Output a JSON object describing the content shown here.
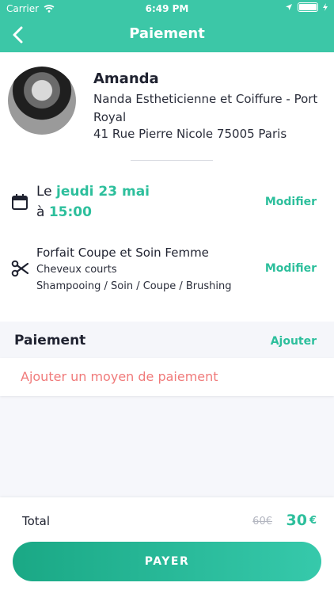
{
  "status_bar": {
    "carrier": "Carrier",
    "time": "6:49 PM"
  },
  "header": {
    "title": "Paiement"
  },
  "provider": {
    "name": "Amanda",
    "salon": "Nanda Estheticienne et Coiffure - Port Royal",
    "address": "41 Rue Pierre Nicole 75005 Paris"
  },
  "appointment": {
    "date_prefix": "Le",
    "date": "jeudi 23 mai",
    "time_prefix": "à",
    "time": "15:00",
    "modify_label": "Modifier"
  },
  "service": {
    "title": "Forfait Coupe et Soin Femme",
    "subtitle": "Cheveux courts",
    "steps": "Shampooing / Soin / Coupe / Brushing",
    "modify_label": "Modifier"
  },
  "payment": {
    "title": "Paiement",
    "add_label": "Ajouter",
    "add_method_label": "Ajouter un moyen de paiement"
  },
  "footer": {
    "total_label": "Total",
    "old_price": "60€",
    "price": "30",
    "currency": "€",
    "pay_button": "PAYER"
  },
  "colors": {
    "accent": "#3cc7a7",
    "link": "#2dbf9c",
    "error": "#f07a7a"
  }
}
